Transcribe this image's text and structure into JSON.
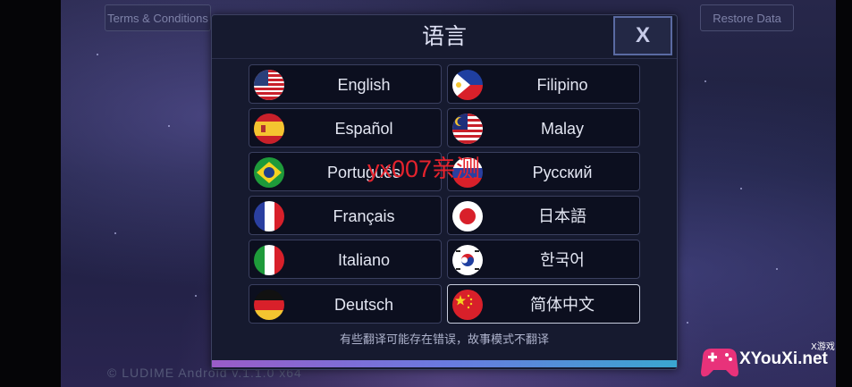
{
  "header_buttons": {
    "terms": "Terms & Conditions",
    "restore": "Restore Data"
  },
  "version_text": "© LUDIME   Android v.1.1.0 x64",
  "dialog": {
    "title": "语言",
    "close_label": "X",
    "note": "有些翻译可能存在错误，故事模式不翻译",
    "languages": [
      {
        "label": "English",
        "flag": "us-flag-icon"
      },
      {
        "label": "Filipino",
        "flag": "ph-flag-icon"
      },
      {
        "label": "Español",
        "flag": "es-flag-icon"
      },
      {
        "label": "Malay",
        "flag": "my-flag-icon"
      },
      {
        "label": "Português",
        "flag": "br-flag-icon"
      },
      {
        "label": "Русский",
        "flag": "ru-flag-icon"
      },
      {
        "label": "Français",
        "flag": "fr-flag-icon"
      },
      {
        "label": "日本語",
        "flag": "jp-flag-icon"
      },
      {
        "label": "Italiano",
        "flag": "it-flag-icon"
      },
      {
        "label": "한국어",
        "flag": "kr-flag-icon"
      },
      {
        "label": "Deutsch",
        "flag": "de-flag-icon"
      },
      {
        "label": "简体中文",
        "flag": "cn-flag-icon",
        "selected": true
      }
    ]
  },
  "watermark": "yx007亲测",
  "logo": {
    "tag": "X游戏",
    "text": "XYouXi.net"
  },
  "colors": {
    "selected_border": "#c6ccdd",
    "progress_start": "#9a5cc8",
    "progress_end": "#3aa6d0",
    "watermark": "#e5232d"
  }
}
